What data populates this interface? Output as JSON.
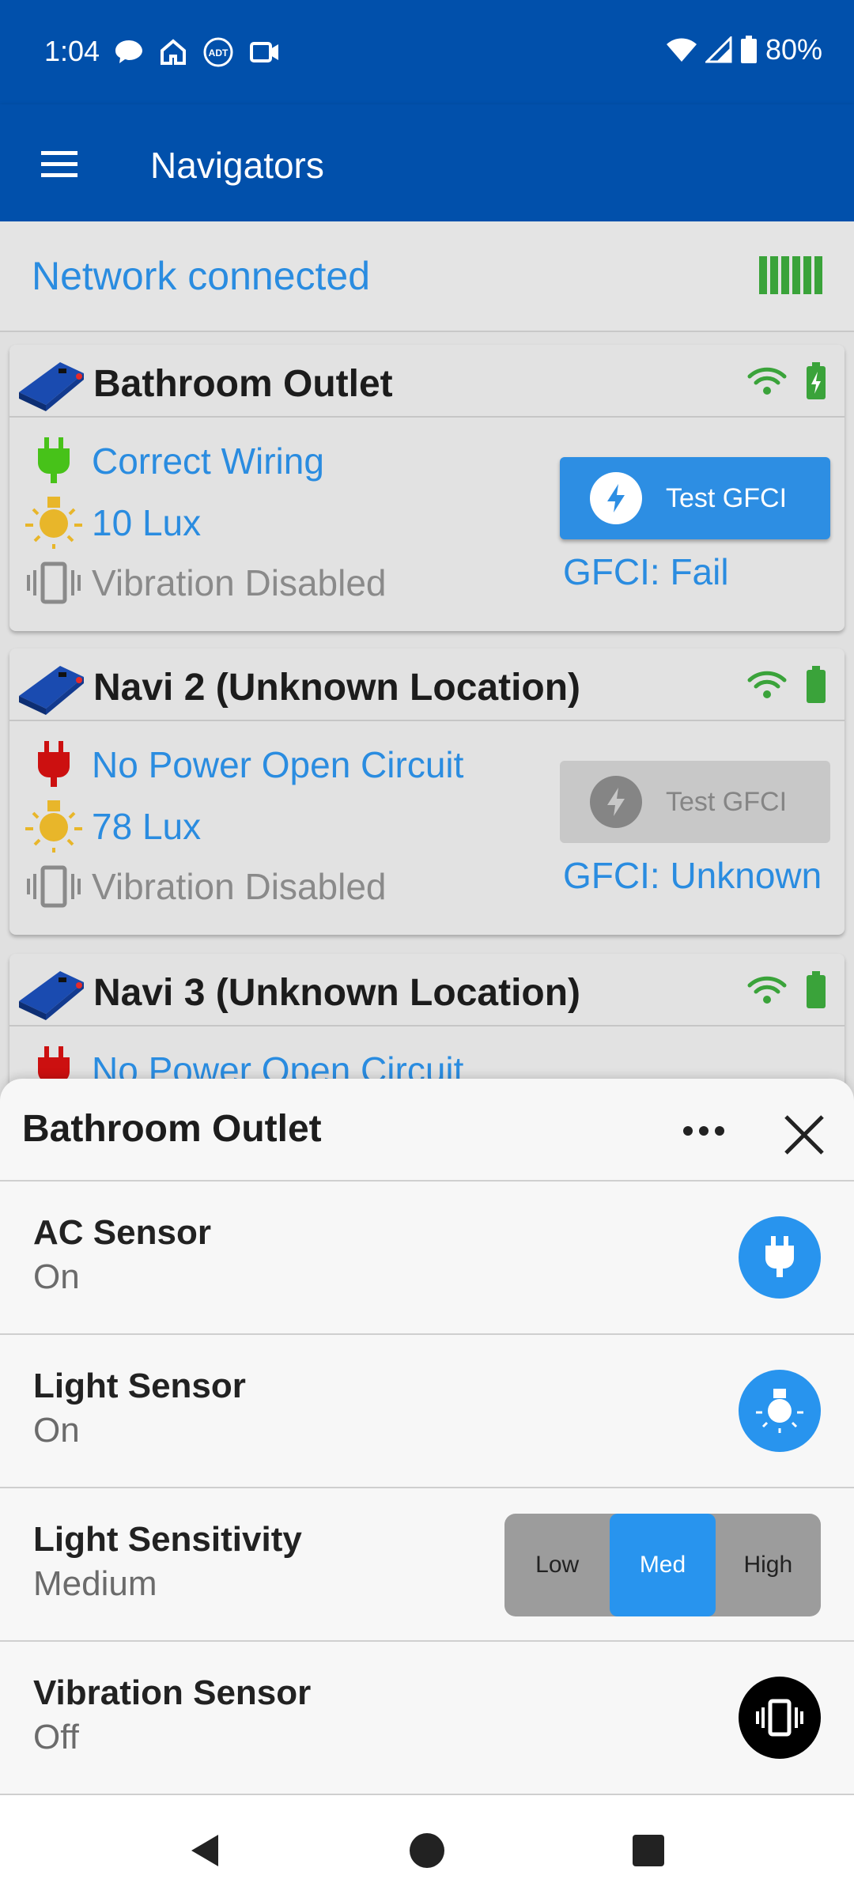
{
  "status_bar": {
    "time": "1:04",
    "battery": "80%",
    "left_icons": [
      "chat-bubble-icon",
      "home-icon",
      "adt-icon",
      "camera-icon"
    ],
    "right_icons": [
      "wifi-icon",
      "cell-signal-icon",
      "battery-icon"
    ]
  },
  "app_bar": {
    "title": "Navigators",
    "menu_icon": "hamburger-menu-icon"
  },
  "network": {
    "status": "Network connected",
    "signal_icon": "signal-bars-icon"
  },
  "cards": [
    {
      "title": "Bathroom Outlet",
      "wiring": "Correct Wiring",
      "wiring_color": "#47c219",
      "lux": "10 Lux",
      "vibration": "Vibration Disabled",
      "button": "Test GFCI",
      "button_enabled": true,
      "gfci": "GFCI: Fail",
      "battery_charging": true
    },
    {
      "title": "Navi 2 (Unknown Location)",
      "wiring": "No Power Open Circuit",
      "wiring_color": "#cc1010",
      "lux": "78 Lux",
      "vibration": "Vibration Disabled",
      "button": "Test GFCI",
      "button_enabled": false,
      "gfci": "GFCI: Unknown",
      "battery_charging": false
    },
    {
      "title": "Navi 3 (Unknown Location)",
      "wiring": "No Power Open Circuit",
      "wiring_color": "#cc1010",
      "battery_charging": false
    }
  ],
  "sheet": {
    "title": "Bathroom Outlet",
    "rows": [
      {
        "label": "AC Sensor",
        "value": "On",
        "icon": "plug-icon",
        "state": "on"
      },
      {
        "label": "Light Sensor",
        "value": "On",
        "icon": "light-bulb-icon",
        "state": "on"
      },
      {
        "label": "Light Sensitivity",
        "value": "Medium",
        "options": [
          "Low",
          "Med",
          "High"
        ],
        "selected": "Med"
      },
      {
        "label": "Vibration Sensor",
        "value": "Off",
        "icon": "vibration-icon",
        "state": "off"
      }
    ]
  },
  "colors": {
    "primary": "#0150ab",
    "accent": "#2894ee",
    "link_text": "#2a8ce0",
    "ok_green": "#3aa33a",
    "light_yellow": "#e8b62a"
  }
}
